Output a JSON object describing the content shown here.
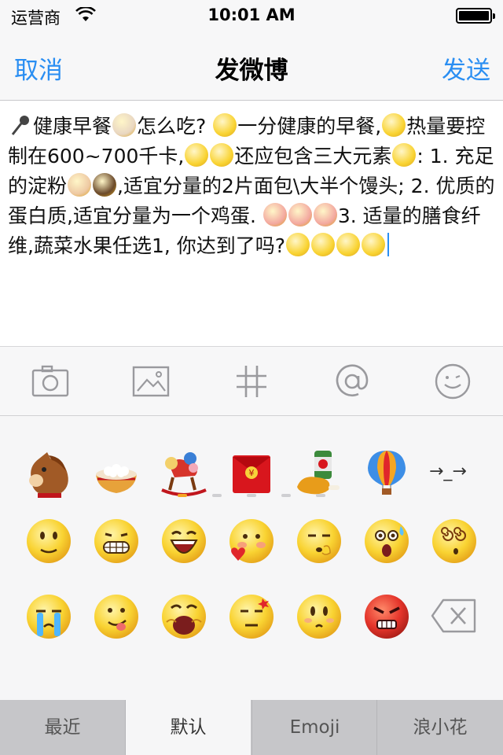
{
  "status_bar": {
    "carrier": "运营商",
    "time": "10:01 AM"
  },
  "nav": {
    "cancel": "取消",
    "title": "发微博",
    "send": "发送"
  },
  "compose": {
    "segments": [
      {
        "emoji": "microphone"
      },
      {
        "text": "健康早餐"
      },
      {
        "emoji": "tangyuan-bowl"
      },
      {
        "text": "怎么吃? "
      },
      {
        "emoji": "surprised-sweat"
      },
      {
        "text": "一分健康的早餐,"
      },
      {
        "emoji": "cool-sunglasses"
      },
      {
        "text": "热量要控制在600~700千卡,"
      },
      {
        "emoji": "sweat-face"
      },
      {
        "emoji": "sweat-face"
      },
      {
        "text": "还应包含三大元素"
      },
      {
        "emoji": "thinking-face"
      },
      {
        "text": ": 1. 充足的淀粉"
      },
      {
        "emoji": "thumbs-up"
      },
      {
        "emoji": "coffee-cup"
      },
      {
        "text": ",适宜分量的2片面包\\大半个馒头; 2. 优质的蛋白质,适宜分量为一个鸡蛋. "
      },
      {
        "emoji": "pig-face"
      },
      {
        "emoji": "pig-face-2"
      },
      {
        "emoji": "pig-face-3"
      },
      {
        "text": "3. 适量的膳食纤维,蔬菜水果任选1, 你达到了吗?"
      },
      {
        "emoji": "grin-face"
      },
      {
        "emoji": "grin-face"
      },
      {
        "emoji": "grin-face"
      },
      {
        "emoji": "grin-face"
      }
    ]
  },
  "toolbar": {
    "items": [
      {
        "icon": "camera-icon"
      },
      {
        "icon": "image-icon"
      },
      {
        "icon": "hashtag-icon"
      },
      {
        "icon": "at-icon"
      },
      {
        "icon": "smiley-icon"
      }
    ]
  },
  "emoji_panel": {
    "rows": [
      [
        "horse-head",
        "tangyuan-bowl",
        "rocking-horse",
        "red-envelope",
        "beer-drumstick",
        "hot-air-balloon",
        "text"
      ],
      [
        "smile",
        "grin",
        "laugh",
        "love-heart",
        "shy-shush",
        "shocked-sweat",
        "dizzy"
      ],
      [
        "crying",
        "tongue-out",
        "yawn",
        "smug",
        "wondering",
        "angry",
        "backspace"
      ]
    ],
    "text_emoji": "→_→",
    "page_count": 5,
    "active_page": 1
  },
  "tabs": [
    {
      "label": "最近",
      "active": false
    },
    {
      "label": "默认",
      "active": true
    },
    {
      "label": "Emoji",
      "active": false
    },
    {
      "label": "浪小花",
      "active": false
    }
  ],
  "colors": {
    "accent": "#2a8ef2",
    "page_dot_active": "#f5a623",
    "emoji_yellow": "#f9d332"
  }
}
